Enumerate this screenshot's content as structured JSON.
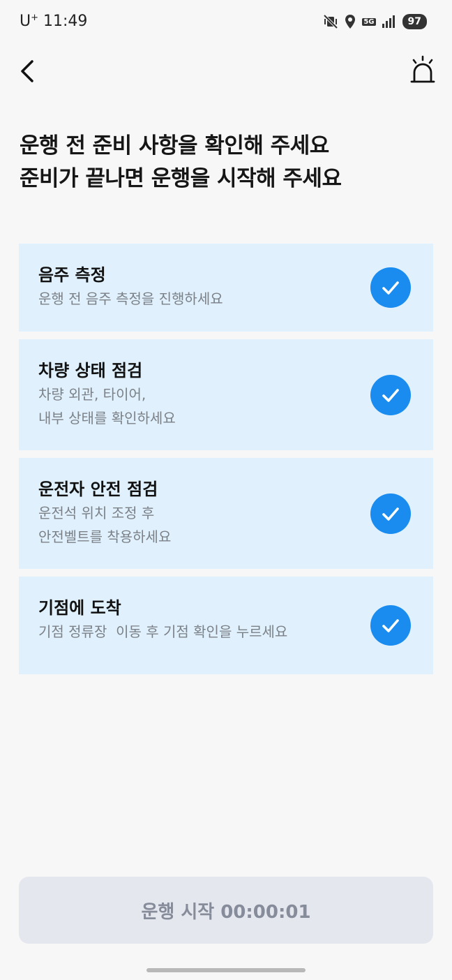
{
  "status_bar": {
    "carrier": "U",
    "carrier_sup": "+",
    "time": "11:49",
    "network": "5G",
    "battery": "97"
  },
  "header": {
    "back_icon": "chevron-left-icon",
    "alarm_icon": "siren-icon"
  },
  "title": {
    "line1": "운행 전 준비 사항을 확인해 주세요",
    "line2": "준비가 끝나면 운행을 시작해 주세요"
  },
  "checklist": [
    {
      "title": "음주 측정",
      "desc_lines": [
        "운행 전 음주 측정을 진행하세요"
      ],
      "checked": true
    },
    {
      "title": "차량 상태 점검",
      "desc_lines": [
        "차량 외관, 타이어,",
        "내부 상태를 확인하세요"
      ],
      "checked": true
    },
    {
      "title": "운전자 안전 점검",
      "desc_lines": [
        "운전석 위치 조정 후",
        "안전벨트를 착용하세요"
      ],
      "checked": true
    },
    {
      "title": "기점에 도착",
      "desc_lines": [
        "기점 정류장  이동 후 기점 확인을 누르세요"
      ],
      "checked": true
    }
  ],
  "start_button": {
    "label": "운행 시작 00:00:01"
  },
  "colors": {
    "card_bg": "#e0f1fd",
    "check_blue": "#1a8cf0",
    "button_bg": "#e5e7ee",
    "button_text": "#878c9b"
  }
}
